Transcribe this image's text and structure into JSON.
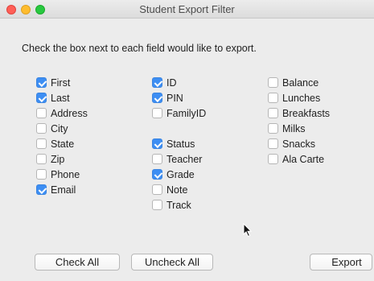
{
  "window": {
    "title": "Student Export Filter"
  },
  "instruction": "Check the box next to each field would like to export.",
  "columns": [
    [
      {
        "label": "First",
        "checked": true
      },
      {
        "label": "Last",
        "checked": true
      },
      {
        "label": "Address",
        "checked": false
      },
      {
        "label": "City",
        "checked": false
      },
      {
        "label": "State",
        "checked": false
      },
      {
        "label": "Zip",
        "checked": false
      },
      {
        "label": "Phone",
        "checked": false
      },
      {
        "label": "Email",
        "checked": true
      }
    ],
    [
      {
        "label": "ID",
        "checked": true
      },
      {
        "label": "PIN",
        "checked": true
      },
      {
        "label": "FamilyID",
        "checked": false
      },
      {
        "label": "Status",
        "checked": true
      },
      {
        "label": "Teacher",
        "checked": false
      },
      {
        "label": "Grade",
        "checked": true
      },
      {
        "label": "Note",
        "checked": false
      },
      {
        "label": "Track",
        "checked": false
      }
    ],
    [
      {
        "label": "Balance",
        "checked": false
      },
      {
        "label": "Lunches",
        "checked": false
      },
      {
        "label": "Breakfasts",
        "checked": false
      },
      {
        "label": "Milks",
        "checked": false
      },
      {
        "label": "Snacks",
        "checked": false
      },
      {
        "label": "Ala Carte",
        "checked": false
      }
    ]
  ],
  "buttons": {
    "check_all": "Check All",
    "uncheck_all": "Uncheck All",
    "export": "Export"
  }
}
